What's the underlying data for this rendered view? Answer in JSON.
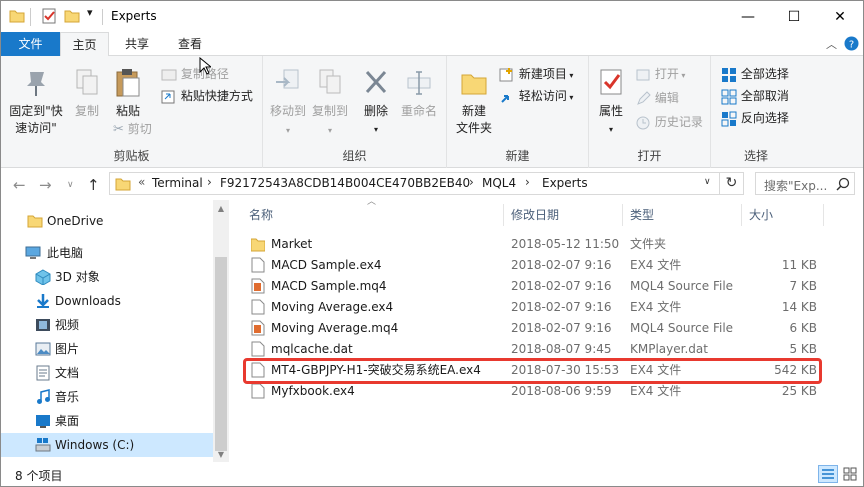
{
  "window": {
    "title": "Experts",
    "minimize": "—",
    "maximize": "☐",
    "close": "✕"
  },
  "ribbon_tabs": [
    "文件",
    "主页",
    "共享",
    "查看"
  ],
  "ribbon": {
    "clipboard": {
      "pin": "固定到\"快速访问\"",
      "pin_line1": "固定到\"快",
      "pin_line2": "速访问\"",
      "copy": "复制",
      "paste": "粘贴",
      "copy_path": "复制路径",
      "paste_shortcut": "粘贴快捷方式",
      "cut": "剪切",
      "group": "剪贴板"
    },
    "organize": {
      "move_to": "移动到",
      "copy_to": "复制到",
      "delete": "删除",
      "rename": "重命名",
      "group": "组织"
    },
    "new": {
      "new_folder_line1": "新建",
      "new_folder_line2": "文件夹",
      "new_item": "新建项目",
      "easy_access": "轻松访问",
      "group": "新建"
    },
    "open": {
      "properties": "属性",
      "open": "打开",
      "edit": "编辑",
      "history": "历史记录",
      "group": "打开"
    },
    "select": {
      "select_all": "全部选择",
      "select_none": "全部取消",
      "invert": "反向选择",
      "group": "选择"
    }
  },
  "address": {
    "prefix": "«",
    "crumbs": [
      "Terminal",
      "F92172543A8CDB14B004CE470BB2EB40",
      "MQL4",
      "Experts"
    ],
    "search_placeholder": "搜索\"Exp..."
  },
  "nav_pane": [
    {
      "label": "OneDrive",
      "icon": "folder-icon"
    },
    {
      "label": "此电脑",
      "icon": "computer-icon"
    },
    {
      "label": "3D 对象",
      "icon": "cube-icon"
    },
    {
      "label": "Downloads",
      "icon": "download-icon"
    },
    {
      "label": "视频",
      "icon": "video-icon"
    },
    {
      "label": "图片",
      "icon": "picture-icon"
    },
    {
      "label": "文档",
      "icon": "document-icon"
    },
    {
      "label": "音乐",
      "icon": "music-icon"
    },
    {
      "label": "桌面",
      "icon": "desktop-icon"
    },
    {
      "label": "Windows (C:)",
      "icon": "drive-icon"
    }
  ],
  "columns": {
    "name": "名称",
    "date": "修改日期",
    "type": "类型",
    "size": "大小"
  },
  "files": [
    {
      "name": "Market",
      "date": "2018-05-12 11:50",
      "type": "文件夹",
      "size": "",
      "icon": "folder"
    },
    {
      "name": "MACD Sample.ex4",
      "date": "2018-02-07 9:16",
      "type": "EX4 文件",
      "size": "11 KB",
      "icon": "file"
    },
    {
      "name": "MACD Sample.mq4",
      "date": "2018-02-07 9:16",
      "type": "MQL4 Source File",
      "size": "7 KB",
      "icon": "mq4"
    },
    {
      "name": "Moving Average.ex4",
      "date": "2018-02-07 9:16",
      "type": "EX4 文件",
      "size": "14 KB",
      "icon": "file"
    },
    {
      "name": "Moving Average.mq4",
      "date": "2018-02-07 9:16",
      "type": "MQL4 Source File",
      "size": "6 KB",
      "icon": "mq4"
    },
    {
      "name": "mqlcache.dat",
      "date": "2018-08-07 9:45",
      "type": "KMPlayer.dat",
      "size": "5 KB",
      "icon": "file"
    },
    {
      "name": "MT4-GBPJPY-H1-突破交易系统EA.ex4",
      "date": "2018-07-30 15:53",
      "type": "EX4 文件",
      "size": "542 KB",
      "icon": "file"
    },
    {
      "name": "Myfxbook.ex4",
      "date": "2018-08-06 9:59",
      "type": "EX4 文件",
      "size": "25 KB",
      "icon": "file"
    }
  ],
  "status": {
    "item_count": "8 个项目"
  },
  "colors": {
    "accent": "#1979ca",
    "highlight": "#e8392f",
    "selection": "#cde8ff",
    "folder": "#f8d775"
  }
}
